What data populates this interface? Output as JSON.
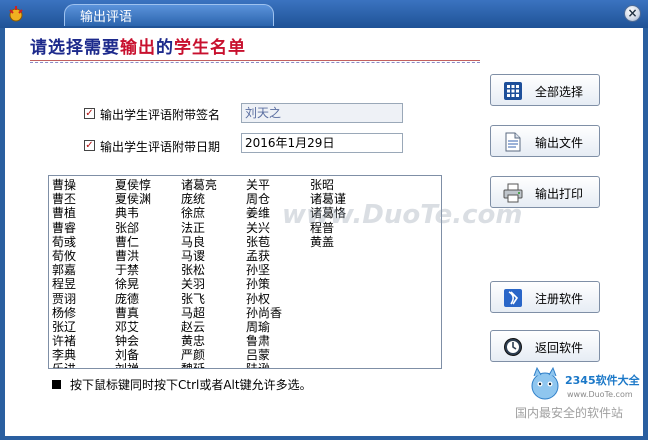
{
  "window": {
    "title": "输出评语"
  },
  "header": {
    "part1": "请选择需要",
    "part2": "输出",
    "part3": "的",
    "part4": "学生名单"
  },
  "options": {
    "signature": {
      "label": "输出学生评语附带签名",
      "value": "刘天之",
      "checked": true
    },
    "date": {
      "label": "输出学生评语附带日期",
      "value": "2016年1月29日",
      "checked": true
    }
  },
  "student_columns": [
    [
      "曹操",
      "曹丕",
      "曹植",
      "曹睿",
      "荀彧",
      "荀攸",
      "郭嘉",
      "程昱",
      "贾诩",
      "杨修",
      "张辽",
      "许褚",
      "李典",
      "乐进"
    ],
    [
      "夏侯惇",
      "夏侯渊",
      "典韦",
      "张郃",
      "曹仁",
      "曹洪",
      "于禁",
      "徐晃",
      "庞德",
      "曹真",
      "邓艾",
      "钟会",
      "刘备",
      "刘禅"
    ],
    [
      "诸葛亮",
      "庞统",
      "徐庶",
      "法正",
      "马良",
      "马谡",
      "张松",
      "关羽",
      "张飞",
      "马超",
      "赵云",
      "黄忠",
      "严颜",
      "魏延"
    ],
    [
      "关平",
      "周仓",
      "姜维",
      "关兴",
      "张苞",
      "孟获",
      "孙坚",
      "孙策",
      "孙权",
      "孙尚香",
      "周瑜",
      "鲁肃",
      "吕蒙",
      "陆逊"
    ],
    [
      "张昭",
      "诸葛谨",
      "诸葛恪",
      "程普",
      "黄盖"
    ]
  ],
  "hint": "按下鼠标键同时按下Ctrl或者Alt键允许多选。",
  "buttons": {
    "select_all": "全部选择",
    "export_file": "输出文件",
    "print": "输出打印",
    "register": "注册软件",
    "back": "返回软件"
  },
  "watermark": "www.DuoTe.com",
  "logo": {
    "main": "2345软件大全",
    "url": "www.DuoTe.com",
    "sub": "国内最安全的软件站"
  }
}
